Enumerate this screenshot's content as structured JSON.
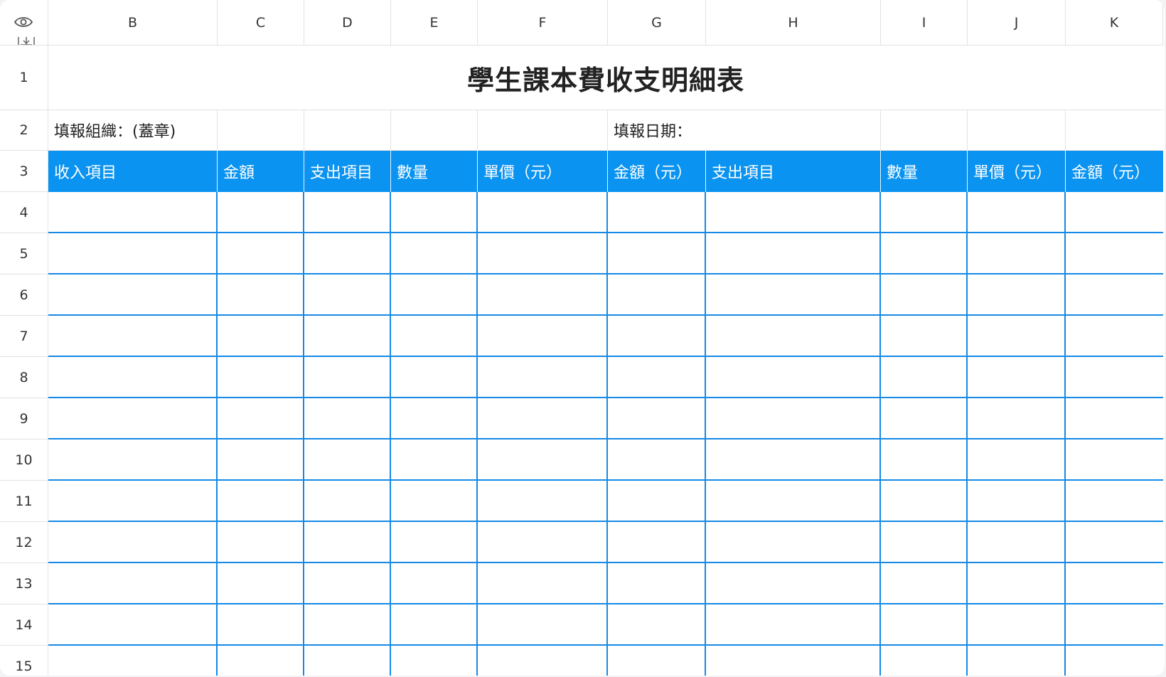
{
  "columns": [
    "B",
    "C",
    "D",
    "E",
    "F",
    "G",
    "H",
    "I",
    "J",
    "K"
  ],
  "rows": [
    "1",
    "2",
    "3",
    "4",
    "5",
    "6",
    "7",
    "8",
    "9",
    "10",
    "11",
    "12",
    "13",
    "14",
    "15"
  ],
  "sheet": {
    "title": "學生課本費收支明細表",
    "fill_org_label": "填報組織：(蓋章)",
    "fill_date_label": "填報日期：",
    "headers": [
      "收入項目",
      "金額",
      "支出項目",
      "數量",
      "單價（元）",
      "金額（元）",
      "支出項目",
      "數量",
      "單價（元）",
      "金額（元）"
    ]
  },
  "icons": {
    "visibility": "eye-icon",
    "row_resize": "row-resize-icon"
  },
  "colors": {
    "header_fill": "#0a93f0",
    "grid_line": "#1589e5"
  }
}
